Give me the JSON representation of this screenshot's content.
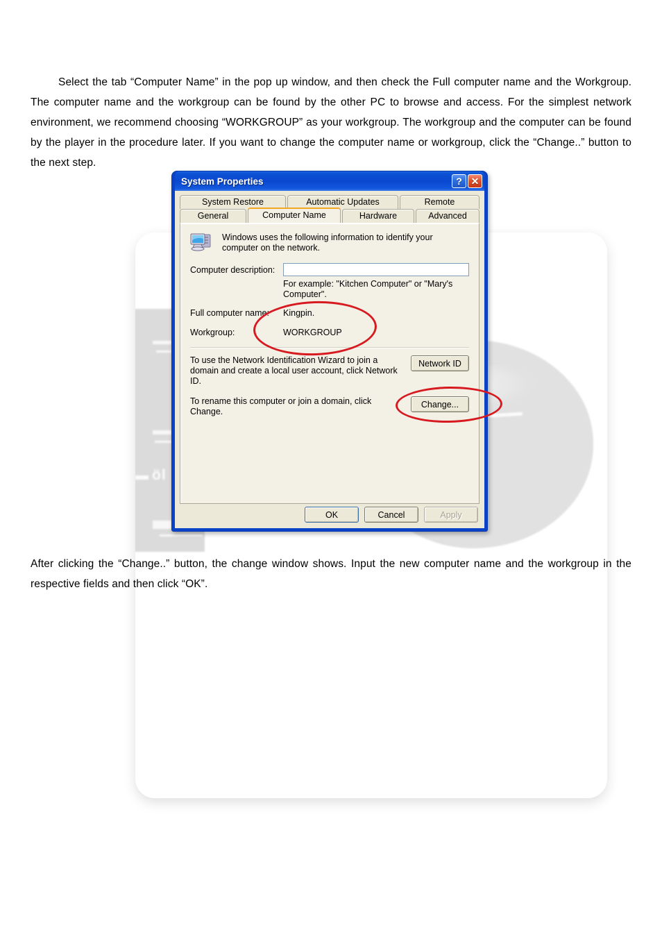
{
  "document": {
    "paragraph_top": "Select the tab “Computer Name” in the pop up window, and then check the Full computer name and the Workgroup. The computer name and the workgroup can be found by the other PC to browse and access. For the simplest network environment, we recommend choosing “WORKGROUP” as your workgroup. The workgroup and the computer can be found by the player in the procedure later. If you want to change the computer name or workgroup, click the “Change..” button to the next step.",
    "paragraph_bottom": "After clicking the “Change..” button, the change window shows. Input the new computer name and the workgroup in the respective fields and then click “OK”."
  },
  "photo": {
    "device_brand_text": "öl"
  },
  "dialog": {
    "title": "System Properties",
    "titlebar_buttons": {
      "help": "?",
      "close": "✕"
    },
    "tabs_row_back": [
      {
        "label": "System Restore",
        "active": false
      },
      {
        "label": "Automatic Updates",
        "active": false
      },
      {
        "label": "Remote",
        "active": false
      }
    ],
    "tabs_row_front": [
      {
        "label": "General",
        "active": false
      },
      {
        "label": "Computer Name",
        "active": true
      },
      {
        "label": "Hardware",
        "active": false
      },
      {
        "label": "Advanced",
        "active": false
      }
    ],
    "panel": {
      "intro": "Windows uses the following information to identify your computer on the network.",
      "computer_description_label": "Computer description:",
      "computer_description_value": "",
      "computer_description_placeholder": "",
      "example_hint": "For example: \"Kitchen Computer\" or \"Mary's Computer\".",
      "full_computer_name_label": "Full computer name:",
      "full_computer_name_value": "Kingpin.",
      "workgroup_label": "Workgroup:",
      "workgroup_value": "WORKGROUP",
      "network_id_text": "To use the Network Identification Wizard to join a domain and create a local user account, click Network ID.",
      "network_id_button": "Network ID",
      "change_text": "To rename this computer or join a domain, click Change.",
      "change_button": "Change..."
    },
    "footer": {
      "ok": "OK",
      "cancel": "Cancel",
      "apply": "Apply"
    }
  },
  "annotations": {
    "accent_color": "#d71920",
    "items": [
      {
        "name": "circle-around-computer-name-and-workgroup"
      },
      {
        "name": "circle-around-change-button"
      }
    ]
  },
  "theme": {
    "titlebar_blue": "#0a47cf",
    "dialog_face": "#ece9d8",
    "panel_face": "#f3f1e6",
    "active_tab_accent": "#f5a623",
    "input_border": "#7f9db9"
  }
}
